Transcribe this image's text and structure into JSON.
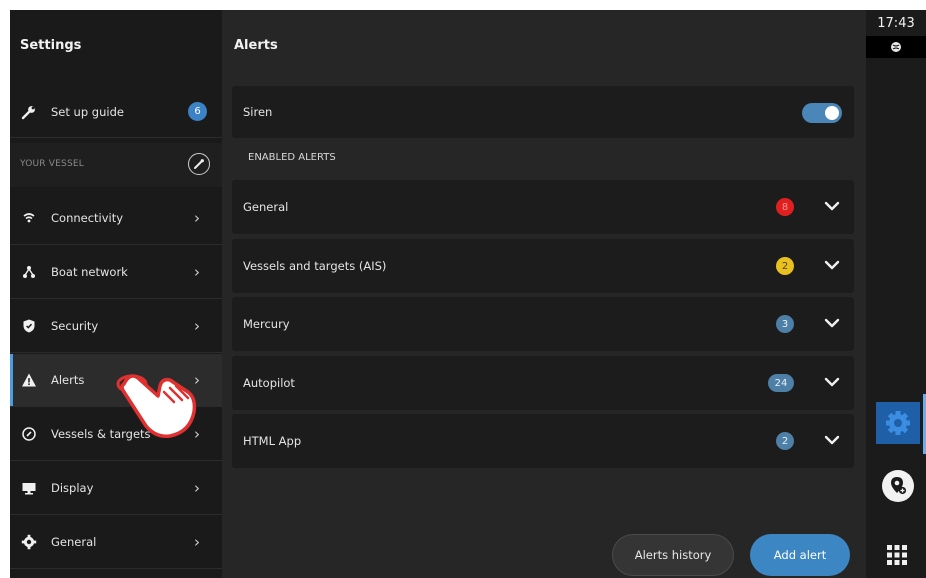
{
  "sidebar": {
    "title": "Settings",
    "setup": {
      "label": "Set up guide",
      "badge": "6",
      "icon": "wrench-icon"
    },
    "section_label": "YOUR VESSEL",
    "items": [
      {
        "label": "Connectivity",
        "icon": "wifi-icon"
      },
      {
        "label": "Boat network",
        "icon": "network-icon"
      },
      {
        "label": "Security",
        "icon": "shield-icon"
      },
      {
        "label": "Alerts",
        "icon": "warning-icon",
        "active": true
      },
      {
        "label": "Vessels & targets",
        "icon": "target-icon"
      },
      {
        "label": "Display",
        "icon": "display-icon"
      },
      {
        "label": "General",
        "icon": "gear-icon"
      }
    ]
  },
  "main": {
    "title": "Alerts",
    "siren": {
      "label": "Siren",
      "enabled": true
    },
    "enabled_header": "ENABLED ALERTS",
    "alerts": [
      {
        "label": "General",
        "count": "8",
        "color": "#e02020"
      },
      {
        "label": "Vessels and targets (AIS)",
        "count": "2",
        "color": "#e8c020"
      },
      {
        "label": "Mercury",
        "count": "3",
        "color": "#4e7fa6"
      },
      {
        "label": "Autopilot",
        "count": "24",
        "color": "#4e7fa6"
      },
      {
        "label": "HTML App",
        "count": "2",
        "color": "#4e7fa6"
      }
    ],
    "buttons": {
      "history": "Alerts history",
      "add": "Add alert"
    }
  },
  "rail": {
    "time": "17:43",
    "status_icon": "globe-icon",
    "accent": "#1f5fa8"
  }
}
